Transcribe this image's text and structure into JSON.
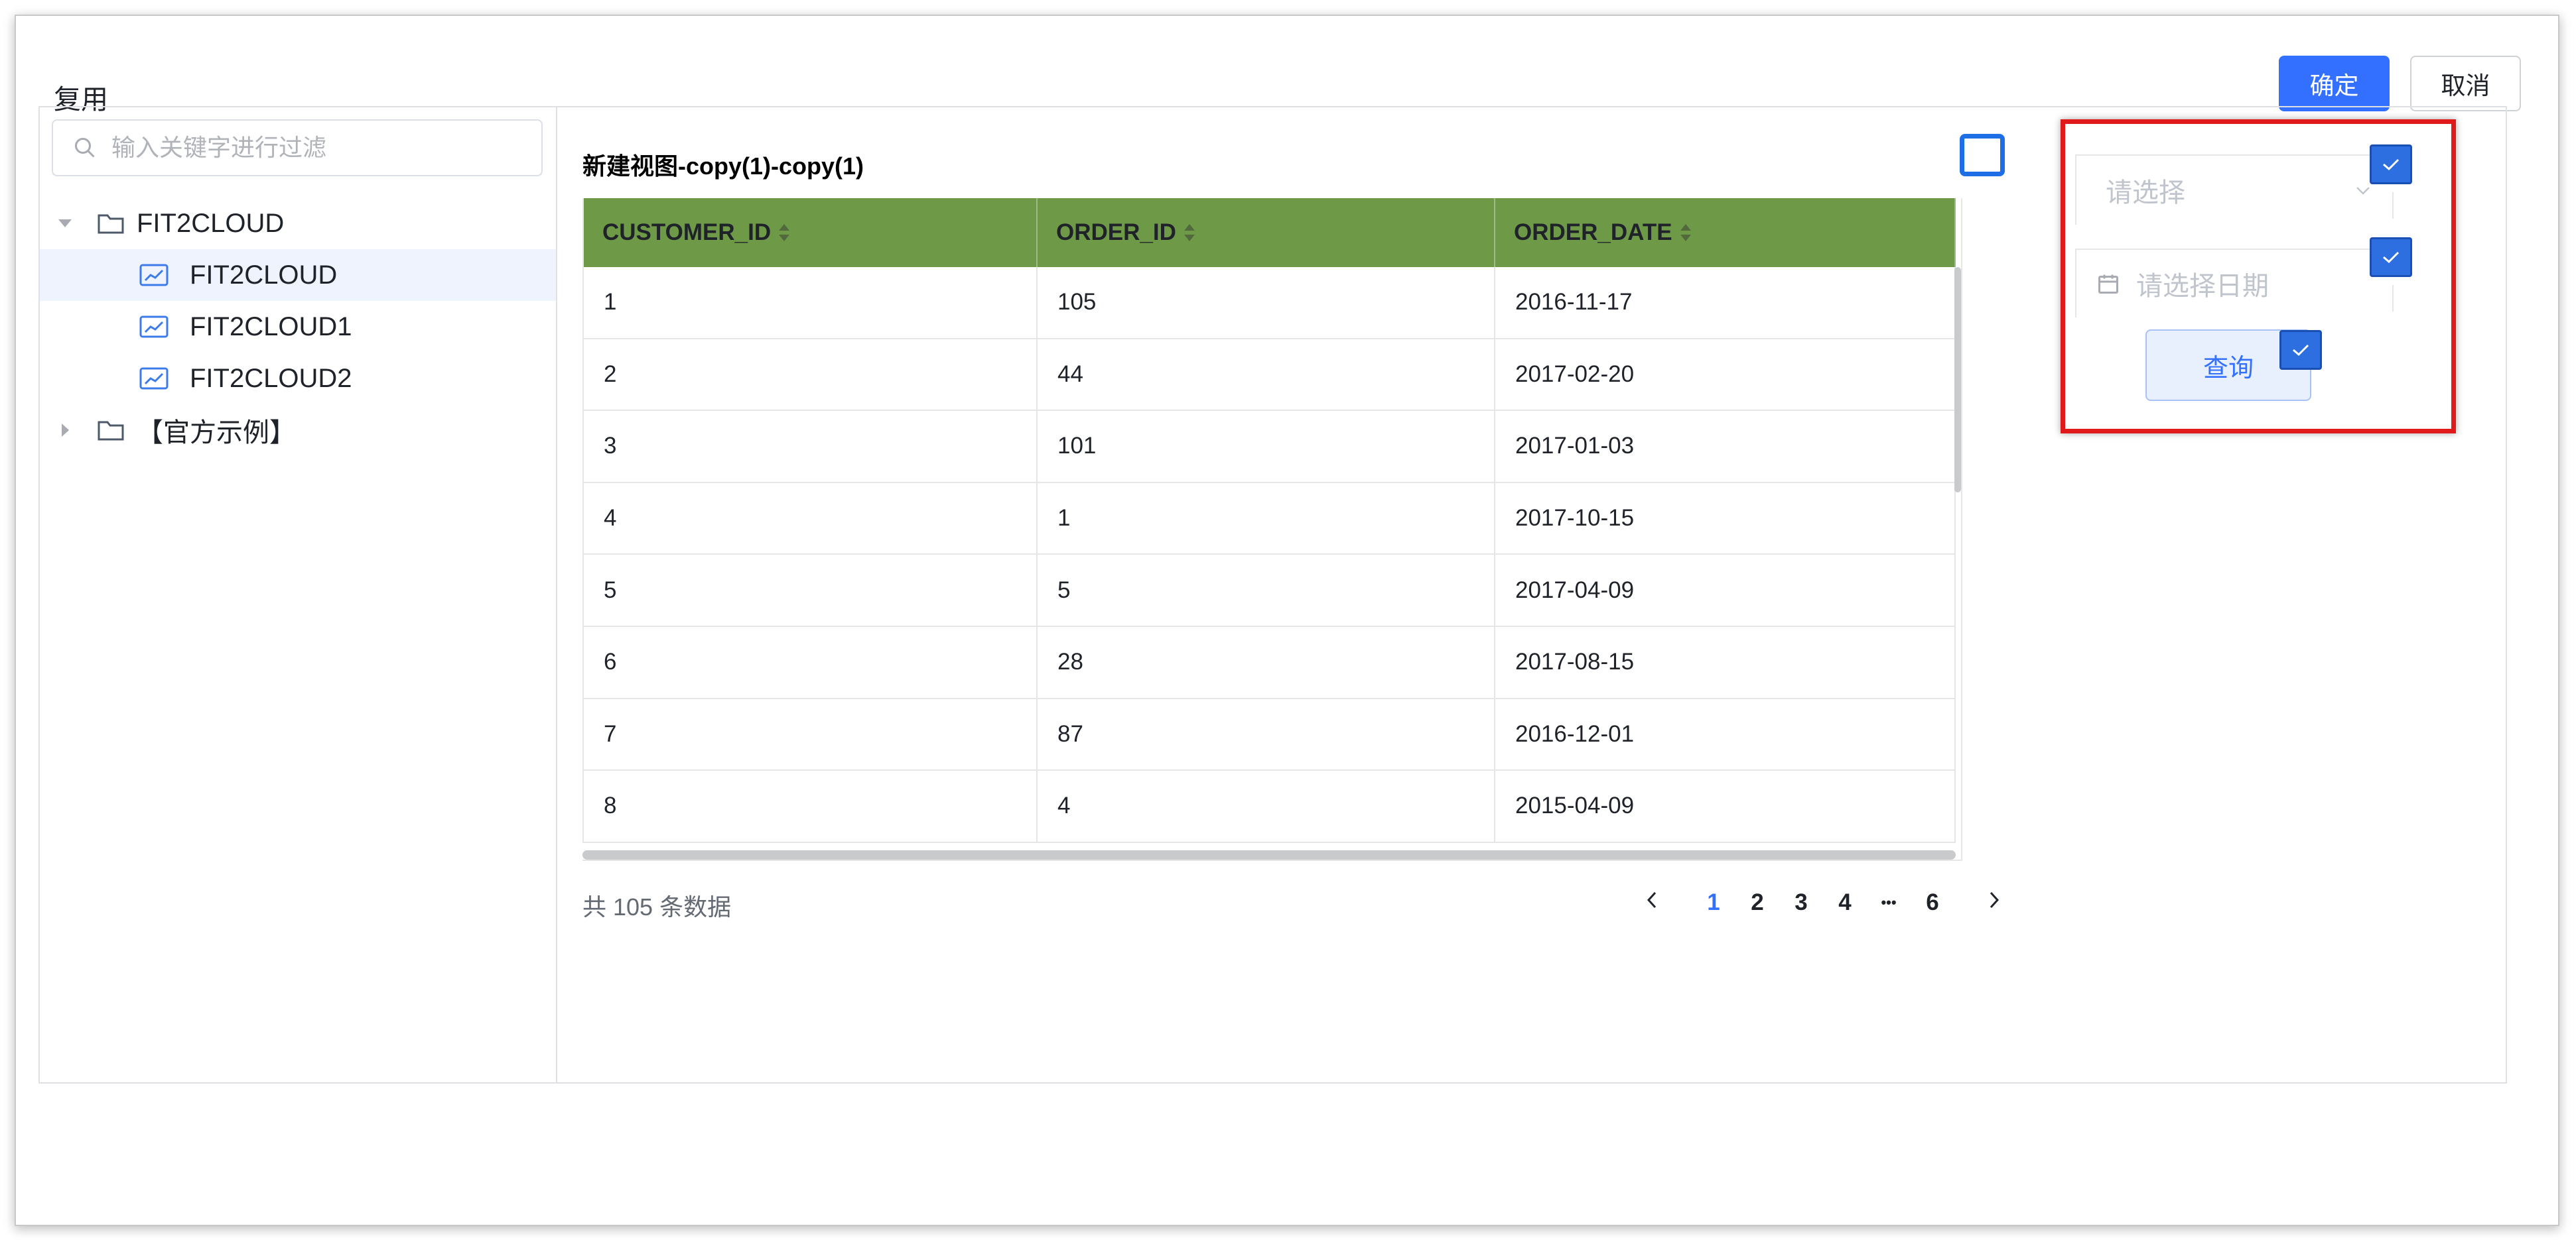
{
  "dialog": {
    "title": "复用",
    "confirm_label": "确定",
    "cancel_label": "取消"
  },
  "search": {
    "placeholder": "输入关键字进行过滤"
  },
  "tree": {
    "folder_fit2cloud": "FIT2CLOUD",
    "items": [
      {
        "label": "FIT2CLOUD",
        "selected": true
      },
      {
        "label": "FIT2CLOUD1",
        "selected": false
      },
      {
        "label": "FIT2CLOUD2",
        "selected": false
      }
    ],
    "folder_examples": "【官方示例】"
  },
  "view": {
    "title": "新建视图-copy(1)-copy(1)",
    "header_color": "#6e9a48",
    "columns": [
      "CUSTOMER_ID",
      "ORDER_ID",
      "ORDER_DATE"
    ],
    "rows": [
      [
        "1",
        "105",
        "2016-11-17"
      ],
      [
        "2",
        "44",
        "2017-02-20"
      ],
      [
        "3",
        "101",
        "2017-01-03"
      ],
      [
        "4",
        "1",
        "2017-10-15"
      ],
      [
        "5",
        "5",
        "2017-04-09"
      ],
      [
        "6",
        "28",
        "2017-08-15"
      ],
      [
        "7",
        "87",
        "2016-12-01"
      ],
      [
        "8",
        "4",
        "2015-04-09"
      ]
    ]
  },
  "pagination": {
    "total_text": "共 105 条数据",
    "prev_icon": "chevron-left-icon",
    "pages": [
      "1",
      "2",
      "3",
      "4"
    ],
    "ellipsis": "•••",
    "last_page": "6",
    "current_page": "1",
    "next_icon": "chevron-right-icon"
  },
  "filters": {
    "select_placeholder": "请选择",
    "date_placeholder": "请选择日期",
    "query_label": "查询",
    "highlight_color": "#e0191b"
  }
}
